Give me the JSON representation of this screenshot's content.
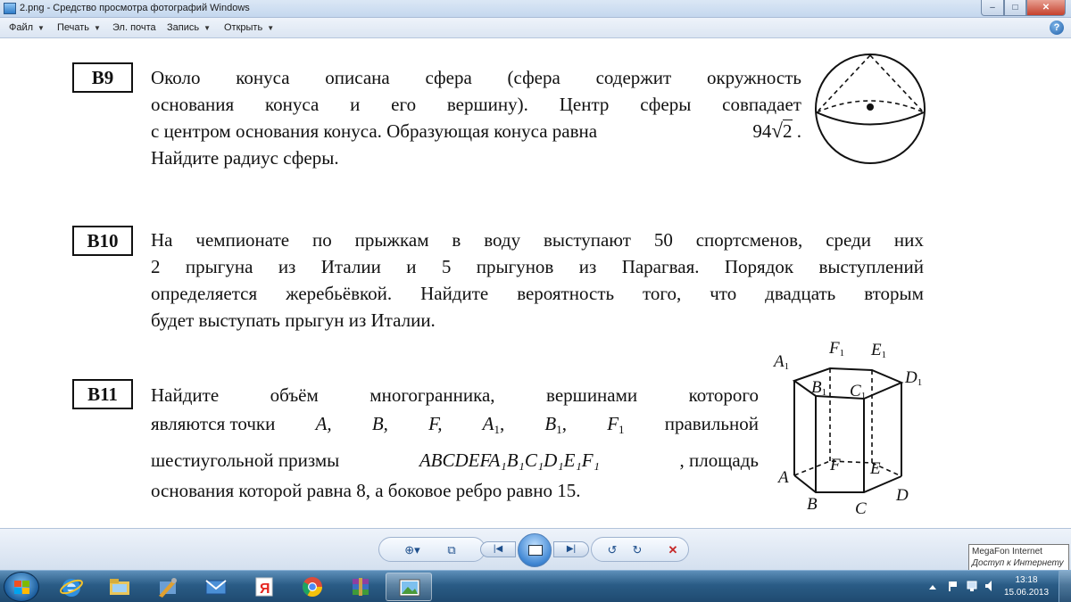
{
  "window": {
    "title": "2.png - Средство просмотра фотографий Windows",
    "buttons": {
      "minimize": "–",
      "maximize": "□",
      "close": "✕"
    }
  },
  "menu": [
    {
      "label": "Файл"
    },
    {
      "label": "Печать"
    },
    {
      "label": "Эл. почта"
    },
    {
      "label": "Запись"
    },
    {
      "label": "Открыть"
    }
  ],
  "help_icon": "question-icon",
  "problems": {
    "b9": {
      "label": "B9",
      "lines": [
        "Около конуса описана сфера (сфера содержит окружность",
        "основания конуса и его вершину). Центр сферы совпадает",
        "с центром основания конуса. Образующая конуса равна",
        "Найдите радиус сферы."
      ],
      "formula_number": "94",
      "formula_radicand": "2",
      "formula_tail": "."
    },
    "b10": {
      "label": "B10",
      "lines": [
        "На чемпионате по прыжкам в воду выступают 50 спортсменов, среди них",
        "2 прыгуна из Италии и 5 прыгунов из Парагвая. Порядок выступлений",
        "определяется жеребьёвкой. Найдите вероятность того, что двадцать вторым",
        "будет выступать прыгун из Италии."
      ]
    },
    "b11": {
      "label": "B11",
      "line1": "Найдите объём многогранника, вершинами которого",
      "line2_prefix": "являются точки",
      "points": [
        "A,",
        "B,",
        "F,",
        "A",
        "1",
        ",",
        "B",
        "1",
        ",",
        "F",
        "1"
      ],
      "line2_suffix": "правильной",
      "line3_prefix": "шестиугольной призмы",
      "prism_name": "ABCDEFA₁B₁C₁D₁E₁F₁",
      "line3_suffix": ", площадь",
      "line4": "основания которой равна 8, а боковое ребро равно 15."
    }
  },
  "prism_labels": {
    "A1": "A",
    "B1": "B",
    "C1": "C",
    "D1": "D",
    "E1": "E",
    "F1": "F",
    "A": "A",
    "B": "B",
    "C": "C",
    "D": "D",
    "E": "E",
    "F": "F",
    "sub": "1"
  },
  "viewer_toolbar": {
    "zoom": "⊕▾",
    "fit": "⧉",
    "prev": "|◀",
    "next": "▶|",
    "rotate_ccw": "↺",
    "rotate_cw": "↻",
    "delete": "✕"
  },
  "tooltip": {
    "line1": "MegaFon Internet",
    "line2": "Доступ к Интернету"
  },
  "clock": {
    "time": "13:18",
    "date": "15.06.2013"
  },
  "tray_icons": [
    "arrow-up-icon",
    "volume-icon",
    "network-icon",
    "flag-icon"
  ],
  "taskbar_apps": [
    "explorer-icon",
    "internet-explorer-icon",
    "folder-icon",
    "tool-icon",
    "mail-icon",
    "yandex-icon",
    "chrome-icon",
    "winrar-icon",
    "photo-viewer-icon"
  ],
  "yandex_letter": "Я"
}
